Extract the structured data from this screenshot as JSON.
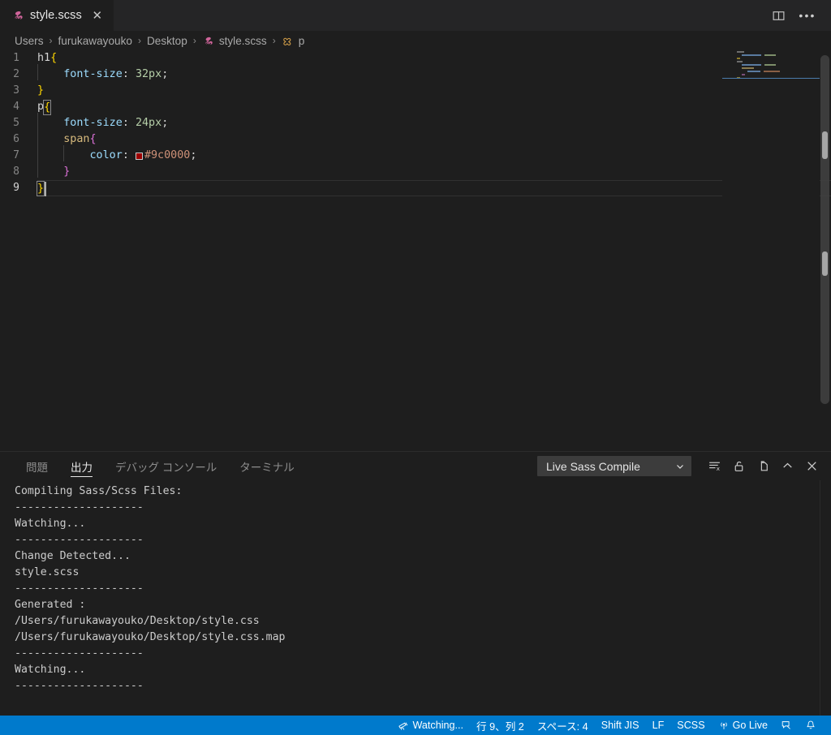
{
  "window": {
    "active_tab": "style.scss",
    "tab_icon": "sass-icon",
    "close_icon": "close-icon",
    "split_editor_icon": "split-editor-icon",
    "more_actions_icon": "more-actions-icon"
  },
  "breadcrumb": {
    "items": [
      {
        "label": "Users",
        "icon": null
      },
      {
        "label": "furukawayouko",
        "icon": null
      },
      {
        "label": "Desktop",
        "icon": null
      },
      {
        "label": "style.scss",
        "icon": "sass-file-icon"
      },
      {
        "label": "p",
        "icon": "css-selector-icon"
      }
    ],
    "separator": "›"
  },
  "editor": {
    "language": "SCSS",
    "active_line": 9,
    "lines": [
      {
        "num": "1",
        "tokens": [
          {
            "t": "h1",
            "c": "sel"
          },
          {
            "t": "{",
            "c": "brace"
          }
        ]
      },
      {
        "num": "2",
        "tokens": [
          {
            "t": "    ",
            "c": "indent"
          },
          {
            "t": "font-size",
            "c": "prop"
          },
          {
            "t": ": ",
            "c": "punc"
          },
          {
            "t": "32px",
            "c": "num"
          },
          {
            "t": ";",
            "c": "punc"
          }
        ]
      },
      {
        "num": "3",
        "tokens": [
          {
            "t": "}",
            "c": "brace"
          }
        ]
      },
      {
        "num": "4",
        "tokens": [
          {
            "t": "p",
            "c": "sel"
          },
          {
            "t": "{",
            "c": "brace-match"
          }
        ]
      },
      {
        "num": "5",
        "tokens": [
          {
            "t": "    ",
            "c": "indent"
          },
          {
            "t": "font-size",
            "c": "prop"
          },
          {
            "t": ": ",
            "c": "punc"
          },
          {
            "t": "24px",
            "c": "num"
          },
          {
            "t": ";",
            "c": "punc"
          }
        ]
      },
      {
        "num": "6",
        "tokens": [
          {
            "t": "    ",
            "c": "indent"
          },
          {
            "t": "span",
            "c": "tag"
          },
          {
            "t": "{",
            "c": "brace2"
          }
        ]
      },
      {
        "num": "7",
        "tokens": [
          {
            "t": "        ",
            "c": "indent"
          },
          {
            "t": "color",
            "c": "prop"
          },
          {
            "t": ": ",
            "c": "punc"
          },
          {
            "t": "#9c0000",
            "c": "hex-swatch"
          },
          {
            "t": ";",
            "c": "punc"
          }
        ]
      },
      {
        "num": "8",
        "tokens": [
          {
            "t": "    ",
            "c": "indent"
          },
          {
            "t": "}",
            "c": "brace2"
          }
        ]
      },
      {
        "num": "9",
        "tokens": [
          {
            "t": "}",
            "c": "brace-match"
          }
        ]
      }
    ],
    "color_swatch": "#9c0000",
    "colors": {
      "selector": "#d4d4d4",
      "brace": "#ffd700",
      "property": "#9cdcfe",
      "number": "#b5cea8",
      "tag": "#d7ba7d",
      "nested_brace": "#da70d6",
      "hex_value": "#ce9178",
      "background": "#1e1e1e",
      "line_number": "#868686"
    }
  },
  "panel": {
    "tabs": [
      {
        "label": "問題",
        "active": false
      },
      {
        "label": "出力",
        "active": true
      },
      {
        "label": "デバッグ コンソール",
        "active": false
      },
      {
        "label": "ターミナル",
        "active": false
      }
    ],
    "channel_selected": "Live Sass Compile",
    "channel_dropdown_icon": "chevron-down-icon",
    "actions": [
      {
        "name": "clear-output-icon"
      },
      {
        "name": "lock-scroll-icon"
      },
      {
        "name": "open-in-editor-icon"
      },
      {
        "name": "maximize-panel-icon"
      },
      {
        "name": "close-panel-icon"
      }
    ],
    "output_lines": [
      "Compiling Sass/Scss Files:",
      "--------------------",
      "Watching...",
      "--------------------",
      "Change Detected...",
      "style.scss",
      "--------------------",
      "Generated :",
      "/Users/furukawayouko/Desktop/style.css",
      "/Users/furukawayouko/Desktop/style.css.map",
      "--------------------",
      "Watching...",
      "--------------------"
    ]
  },
  "statusbar": {
    "background": "#007acc",
    "items": [
      {
        "icon": "telescope-icon",
        "label": "Watching..."
      },
      {
        "icon": null,
        "label": "行 9、列 2"
      },
      {
        "icon": null,
        "label": "スペース: 4"
      },
      {
        "icon": null,
        "label": "Shift JIS"
      },
      {
        "icon": null,
        "label": "LF"
      },
      {
        "icon": null,
        "label": "SCSS"
      },
      {
        "icon": "broadcast-icon",
        "label": "Go Live"
      },
      {
        "icon": "feedback-icon",
        "label": ""
      },
      {
        "icon": "bell-icon",
        "label": ""
      }
    ]
  }
}
